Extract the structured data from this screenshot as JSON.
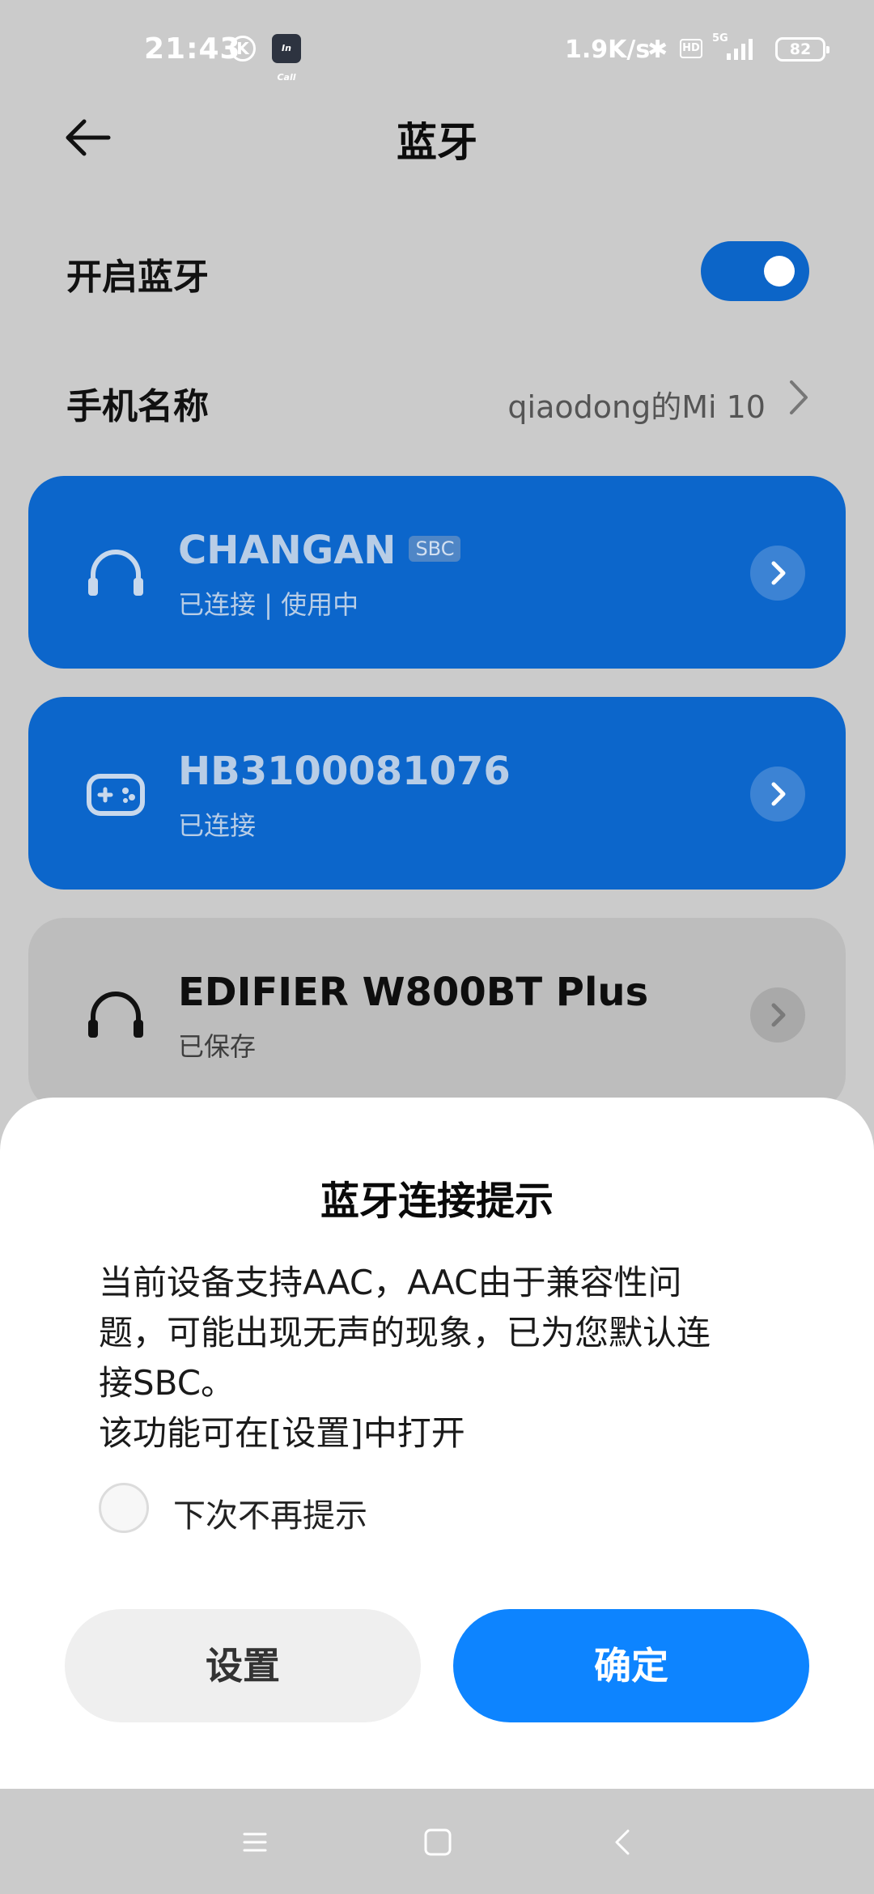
{
  "status_bar": {
    "time": "21:43",
    "k_icon_letter": "K",
    "app_icon_text": "In Call",
    "net_speed": "1.9K/s",
    "bluetooth_glyph": "✱",
    "hd_label": "HD",
    "network_type": "5G",
    "battery": "82"
  },
  "header": {
    "title": "蓝牙"
  },
  "bluetooth_toggle": {
    "label": "开启蓝牙",
    "enabled": true
  },
  "phone_name": {
    "label": "手机名称",
    "value": "qiaodong的Mi 10"
  },
  "devices": [
    {
      "name": "CHANGAN",
      "codec": "SBC",
      "status": "已连接 | 使用中",
      "icon": "headphones-icon"
    },
    {
      "name": "HB3100081076",
      "status": "已连接",
      "icon": "gamepad-icon"
    },
    {
      "name": "EDIFIER W800BT Plus",
      "status": "已保存",
      "icon": "headphones-icon"
    }
  ],
  "dialog": {
    "title": "蓝牙连接提示",
    "message_lines": [
      "当前设备支持AAC，AAC由于兼容性问",
      "题，可能出现无声的现象，已为您默认连",
      "接SBC。",
      "该功能可在[设置]中打开"
    ],
    "checkbox_label": "下次不再提示",
    "checkbox_checked": false,
    "settings_button": "设置",
    "confirm_button": "确定"
  },
  "colors": {
    "accent": "#0d84ff",
    "connected_card": "#0c66cb",
    "dimmed_background": "#cbcbcb"
  }
}
